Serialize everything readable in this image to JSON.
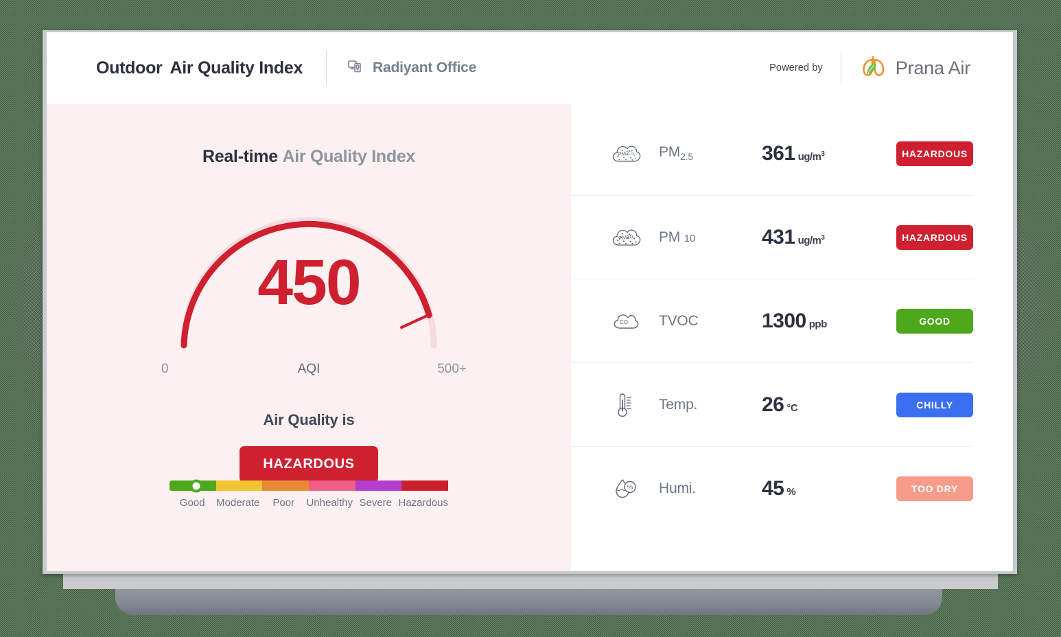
{
  "header": {
    "title_strong": "Outdoor",
    "title_light": "Air Quality Index",
    "device_icon": "device-monitor-icon",
    "device_name": "Radiyant Office",
    "powered_by": "Powered by",
    "brand_name": "Prana Air",
    "brand_logo_icon": "prana-air-lungs-leaf-logo"
  },
  "left_panel": {
    "section_title_strong": "Real-time",
    "section_title_light": "Air Quality Index",
    "status_label": "Air Quality is",
    "status_value": "HAZARDOUS",
    "status_color": "#cf2030"
  },
  "chart_data": {
    "type": "gauge",
    "title": "Real-time Air Quality Index",
    "value": 450,
    "unit": "AQI",
    "min_label": "0",
    "max_label": "500+",
    "range": [
      0,
      500
    ],
    "fill_color": "#cf2030",
    "track_color": "#f7dadd",
    "categories": [
      "Good",
      "Moderate",
      "Poor",
      "Unhealthy",
      "Severe",
      "Hazardous"
    ],
    "category_colors": [
      "#4fa81c",
      "#f0c330",
      "#e88a33",
      "#ef5f85",
      "#b23fce",
      "#cc1f2e"
    ],
    "marker_category": "Good",
    "marker_position_pct": 9.5,
    "marker_color": "#4fa81c"
  },
  "metrics": [
    {
      "icon": "cloud-pm25-icon",
      "label_main": "PM",
      "label_sub": "2.5",
      "value": "361",
      "unit": "ug/m",
      "unit_sup": "3",
      "badge": "HAZARDOUS",
      "badge_color": "#cf2030"
    },
    {
      "icon": "cloud-pm10-icon",
      "label_main": "PM",
      "label_sub": "10",
      "value": "431",
      "unit": "ug/m",
      "unit_sup": "3",
      "badge": "HAZARDOUS",
      "badge_color": "#cf2030"
    },
    {
      "icon": "cloud-co-icon",
      "label_main": "TVOC",
      "label_sub": "",
      "value": "1300",
      "unit": "ppb",
      "unit_sup": "",
      "badge": "GOOD",
      "badge_color": "#4fa81c"
    },
    {
      "icon": "thermometer-icon",
      "label_main": "Temp.",
      "label_sub": "",
      "value": "26",
      "unit": "°C",
      "unit_sup": "",
      "badge": "CHILLY",
      "badge_color": "#3b6fef"
    },
    {
      "icon": "humidity-droplet-percent-icon",
      "label_main": "Humi.",
      "label_sub": "",
      "value": "45",
      "unit": "%",
      "unit_sup": "",
      "badge": "TOO DRY",
      "badge_color": "#f79c8a"
    }
  ]
}
